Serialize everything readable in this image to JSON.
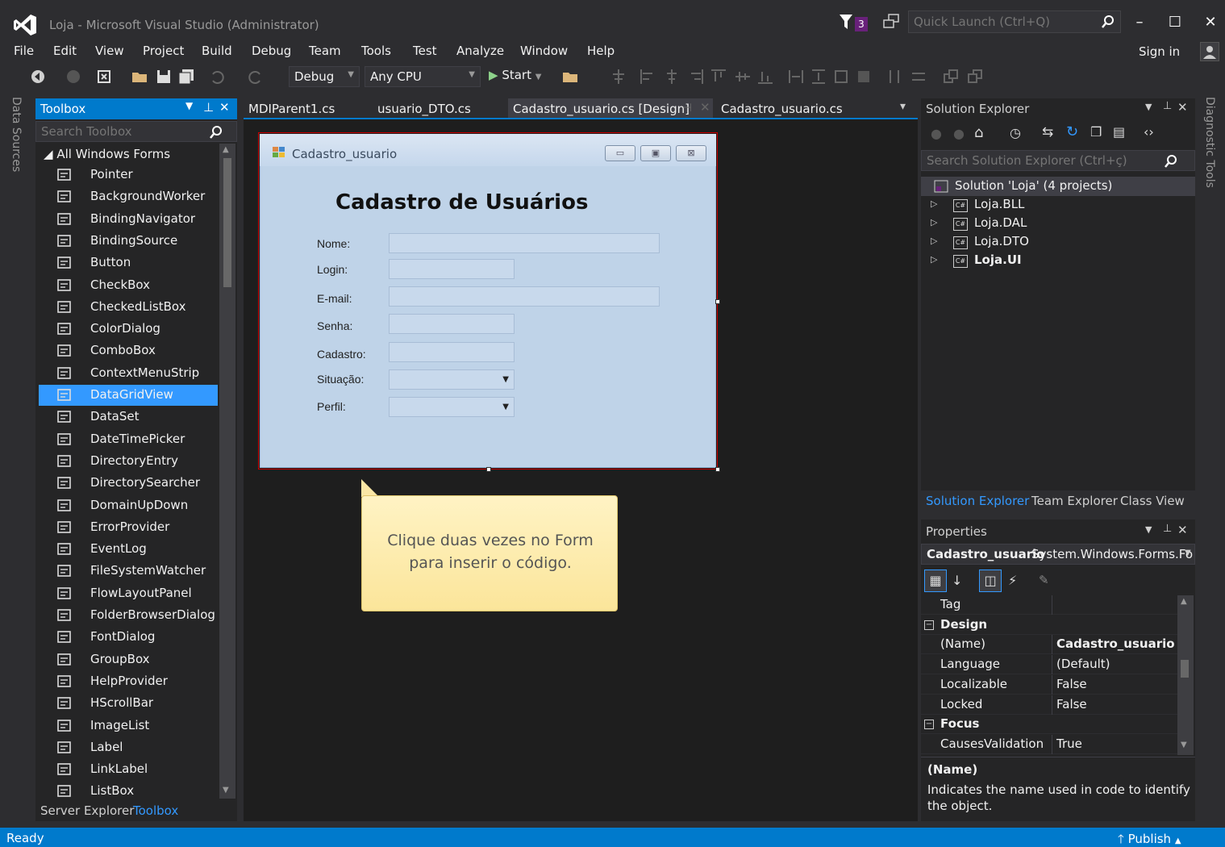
{
  "window": {
    "title": "Loja - Microsoft Visual Studio (Administrator)",
    "notification_count": "3",
    "quick_launch_placeholder": "Quick Launch (Ctrl+Q)",
    "minimize": "–",
    "maximize": "☐",
    "close": "✕",
    "sign_in": "Sign in"
  },
  "menu": [
    "File",
    "Edit",
    "View",
    "Project",
    "Build",
    "Debug",
    "Team",
    "Tools",
    "Test",
    "Analyze",
    "Window",
    "Help"
  ],
  "toolbar": {
    "config": "Debug",
    "platform": "Any CPU",
    "start": "Start"
  },
  "left_strip": {
    "data_sources": "Data Sources"
  },
  "right_strip": {
    "diagnostic_tools": "Diagnostic Tools"
  },
  "toolbox": {
    "title": "Toolbox",
    "search_placeholder": "Search Toolbox",
    "group": "All Windows Forms",
    "items": [
      {
        "label": "Pointer",
        "icon": "pointer-icon"
      },
      {
        "label": "BackgroundWorker",
        "icon": "backgroundworker-icon"
      },
      {
        "label": "BindingNavigator",
        "icon": "bindingnavigator-icon"
      },
      {
        "label": "BindingSource",
        "icon": "bindingsource-icon"
      },
      {
        "label": "Button",
        "icon": "button-icon"
      },
      {
        "label": "CheckBox",
        "icon": "checkbox-icon"
      },
      {
        "label": "CheckedListBox",
        "icon": "checkedlistbox-icon"
      },
      {
        "label": "ColorDialog",
        "icon": "colordialog-icon"
      },
      {
        "label": "ComboBox",
        "icon": "combobox-icon"
      },
      {
        "label": "ContextMenuStrip",
        "icon": "contextmenustrip-icon"
      },
      {
        "label": "DataGridView",
        "icon": "datagridview-icon"
      },
      {
        "label": "DataSet",
        "icon": "dataset-icon"
      },
      {
        "label": "DateTimePicker",
        "icon": "datetimepicker-icon"
      },
      {
        "label": "DirectoryEntry",
        "icon": "directoryentry-icon"
      },
      {
        "label": "DirectorySearcher",
        "icon": "directorysearcher-icon"
      },
      {
        "label": "DomainUpDown",
        "icon": "domainupdown-icon"
      },
      {
        "label": "ErrorProvider",
        "icon": "errorprovider-icon"
      },
      {
        "label": "EventLog",
        "icon": "eventlog-icon"
      },
      {
        "label": "FileSystemWatcher",
        "icon": "filesystemwatcher-icon"
      },
      {
        "label": "FlowLayoutPanel",
        "icon": "flowlayoutpanel-icon"
      },
      {
        "label": "FolderBrowserDialog",
        "icon": "folderbrowserdialog-icon"
      },
      {
        "label": "FontDialog",
        "icon": "fontdialog-icon"
      },
      {
        "label": "GroupBox",
        "icon": "groupbox-icon"
      },
      {
        "label": "HelpProvider",
        "icon": "helpprovider-icon"
      },
      {
        "label": "HScrollBar",
        "icon": "hscrollbar-icon"
      },
      {
        "label": "ImageList",
        "icon": "imagelist-icon"
      },
      {
        "label": "Label",
        "icon": "label-icon"
      },
      {
        "label": "LinkLabel",
        "icon": "linklabel-icon"
      },
      {
        "label": "ListBox",
        "icon": "listbox-icon"
      }
    ],
    "selected": "DataGridView",
    "bottom_tabs": [
      "Server Explorer",
      "Toolbox"
    ]
  },
  "doc_tabs": [
    "MDIParent1.cs",
    "usuario_DTO.cs",
    "Cadastro_usuario.cs [Design]",
    "Cadastro_usuario.cs"
  ],
  "form": {
    "title": "Cadastro_usuario",
    "heading": "Cadastro de Usuários",
    "fields": [
      {
        "label": "Nome:",
        "type": "text"
      },
      {
        "label": "Login:",
        "type": "text"
      },
      {
        "label": "E-mail:",
        "type": "text"
      },
      {
        "label": "Senha:",
        "type": "text"
      },
      {
        "label": "Cadastro:",
        "type": "text"
      },
      {
        "label": "Situação:",
        "type": "combo"
      },
      {
        "label": "Perfil:",
        "type": "combo"
      }
    ]
  },
  "tooltip": {
    "line1": "Clique duas vezes no Form",
    "line2": "para inserir o código."
  },
  "solution_explorer": {
    "title": "Solution Explorer",
    "search_placeholder": "Search Solution Explorer (Ctrl+ç)",
    "root": "Solution 'Loja' (4 projects)",
    "projects": [
      "Loja.BLL",
      "Loja.DAL",
      "Loja.DTO",
      "Loja.UI"
    ],
    "tabs": [
      "Solution Explorer",
      "Team Explorer",
      "Class View"
    ]
  },
  "properties": {
    "title": "Properties",
    "object_name": "Cadastro_usuario",
    "object_type": "System.Windows.Forms.Fo",
    "rows": [
      {
        "name": "Tag",
        "value": "",
        "category": false
      },
      {
        "name": "Design",
        "value": "",
        "category": true
      },
      {
        "name": "(Name)",
        "value": "Cadastro_usuario",
        "category": false,
        "bold": true
      },
      {
        "name": "Language",
        "value": "(Default)",
        "category": false
      },
      {
        "name": "Localizable",
        "value": "False",
        "category": false
      },
      {
        "name": "Locked",
        "value": "False",
        "category": false
      },
      {
        "name": "Focus",
        "value": "",
        "category": true
      },
      {
        "name": "CausesValidation",
        "value": "True",
        "category": false
      }
    ],
    "desc_title": "(Name)",
    "desc_text": "Indicates the name used in code to identify the object."
  },
  "status": {
    "text": "Ready",
    "publish": "Publish"
  },
  "colors": {
    "accent": "#007acc",
    "selection": "#3399ff",
    "background": "#2d2d30",
    "panel": "#252526"
  }
}
